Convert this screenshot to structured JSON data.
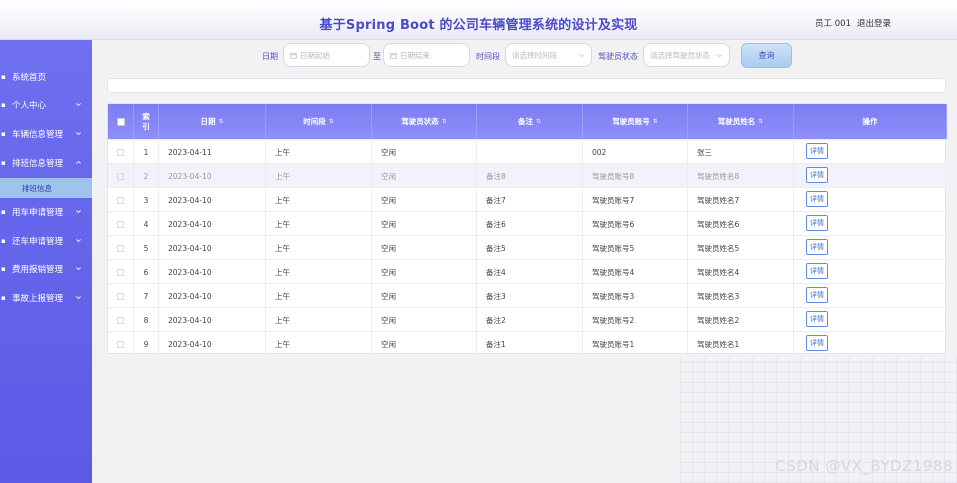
{
  "header": {
    "title": "基于Spring Boot 的公司车辆管理系统的设计及实现",
    "user": "员工 001",
    "logout": "退出登录"
  },
  "sidebar": {
    "items": [
      {
        "label": "系统首页",
        "icon": "home-icon",
        "has_chevron": false
      },
      {
        "label": "个人中心",
        "icon": "user-icon",
        "has_chevron": true
      },
      {
        "label": "车辆信息管理",
        "icon": "car-icon",
        "has_chevron": true
      },
      {
        "label": "排班信息管理",
        "icon": "calendar-icon",
        "has_chevron": true,
        "expanded": true
      },
      {
        "label": "用车申请管理",
        "icon": "document-icon",
        "has_chevron": true
      },
      {
        "label": "还车申请管理",
        "icon": "document-icon",
        "has_chevron": true
      },
      {
        "label": "费用报销管理",
        "icon": "document-icon",
        "has_chevron": true
      },
      {
        "label": "事故上报管理",
        "icon": "document-icon",
        "has_chevron": true
      }
    ],
    "sub_item": "排班信息"
  },
  "search": {
    "date_label": "日期",
    "date_start_placeholder": "日期起始",
    "to_label": "至",
    "date_end_placeholder": "日期结束",
    "period_label": "时间段",
    "period_placeholder": "请选择时间段",
    "status_label": "驾驶员状态",
    "status_placeholder": "请选择驾驶员状态",
    "query_button": "查询"
  },
  "table": {
    "headers": [
      "索引",
      "日期",
      "时间段",
      "驾驶员状态",
      "备注",
      "驾驶员账号",
      "驾驶员姓名",
      "操作"
    ],
    "rows": [
      {
        "idx": "1",
        "date": "2023-04-11",
        "period": "上午",
        "status": "空闲",
        "note": "",
        "account": "002",
        "name": "张三"
      },
      {
        "idx": "2",
        "date": "2023-04-10",
        "period": "上午",
        "status": "空闲",
        "note": "备注8",
        "account": "驾驶员账号8",
        "name": "驾驶员姓名8"
      },
      {
        "idx": "3",
        "date": "2023-04-10",
        "period": "上午",
        "status": "空闲",
        "note": "备注7",
        "account": "驾驶员账号7",
        "name": "驾驶员姓名7"
      },
      {
        "idx": "4",
        "date": "2023-04-10",
        "period": "上午",
        "status": "空闲",
        "note": "备注6",
        "account": "驾驶员账号6",
        "name": "驾驶员姓名6"
      },
      {
        "idx": "5",
        "date": "2023-04-10",
        "period": "上午",
        "status": "空闲",
        "note": "备注5",
        "account": "驾驶员账号5",
        "name": "驾驶员姓名5"
      },
      {
        "idx": "6",
        "date": "2023-04-10",
        "period": "上午",
        "status": "空闲",
        "note": "备注4",
        "account": "驾驶员账号4",
        "name": "驾驶员姓名4"
      },
      {
        "idx": "7",
        "date": "2023-04-10",
        "period": "上午",
        "status": "空闲",
        "note": "备注3",
        "account": "驾驶员账号3",
        "name": "驾驶员姓名3"
      },
      {
        "idx": "8",
        "date": "2023-04-10",
        "period": "上午",
        "status": "空闲",
        "note": "备注2",
        "account": "驾驶员账号2",
        "name": "驾驶员姓名2"
      },
      {
        "idx": "9",
        "date": "2023-04-10",
        "period": "上午",
        "status": "空闲",
        "note": "备注1",
        "account": "驾驶员账号1",
        "name": "驾驶员姓名1"
      }
    ],
    "detail_button": "详情"
  },
  "watermark": "CSDN @VX_BYDZ1988",
  "colors": {
    "accent": "#5a5ae6",
    "header_title": "#4a4bc9",
    "table_header": "#7c7cf3"
  }
}
